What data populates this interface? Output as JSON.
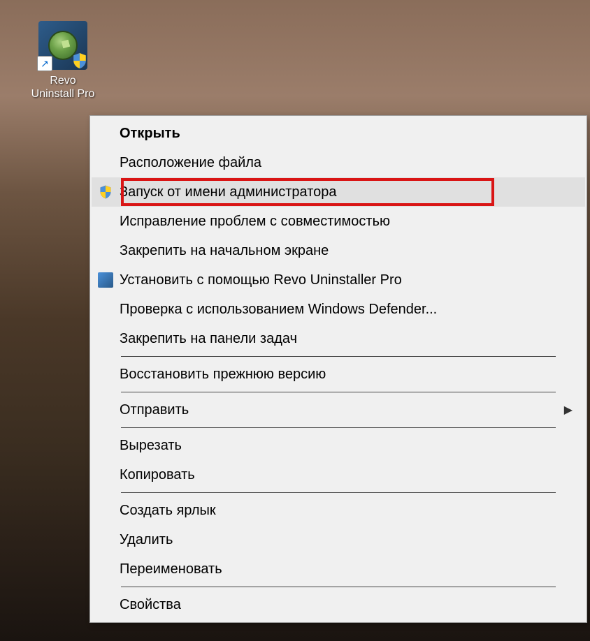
{
  "desktop": {
    "icon_label": "Revo Uninstall Pro"
  },
  "context_menu": {
    "items": [
      {
        "label": "Открыть",
        "bold": true,
        "icon": null,
        "submenu": false,
        "highlighted": false
      },
      {
        "label": "Расположение файла",
        "bold": false,
        "icon": null,
        "submenu": false,
        "highlighted": false
      },
      {
        "label": "Запуск от имени администратора",
        "bold": false,
        "icon": "shield",
        "submenu": false,
        "highlighted": true
      },
      {
        "label": "Исправление проблем с совместимостью",
        "bold": false,
        "icon": null,
        "submenu": false,
        "highlighted": false
      },
      {
        "label": "Закрепить на начальном экране",
        "bold": false,
        "icon": null,
        "submenu": false,
        "highlighted": false
      },
      {
        "label": "Установить с помощью Revo Uninstaller Pro",
        "bold": false,
        "icon": "revo",
        "submenu": false,
        "highlighted": false
      },
      {
        "label": "Проверка с использованием Windows Defender...",
        "bold": false,
        "icon": null,
        "submenu": false,
        "highlighted": false
      },
      {
        "label": "Закрепить на панели задач",
        "bold": false,
        "icon": null,
        "submenu": false,
        "highlighted": false
      },
      {
        "separator": true
      },
      {
        "label": "Восстановить прежнюю версию",
        "bold": false,
        "icon": null,
        "submenu": false,
        "highlighted": false
      },
      {
        "separator": true
      },
      {
        "label": "Отправить",
        "bold": false,
        "icon": null,
        "submenu": true,
        "highlighted": false
      },
      {
        "separator": true
      },
      {
        "label": "Вырезать",
        "bold": false,
        "icon": null,
        "submenu": false,
        "highlighted": false
      },
      {
        "label": "Копировать",
        "bold": false,
        "icon": null,
        "submenu": false,
        "highlighted": false
      },
      {
        "separator": true
      },
      {
        "label": "Создать ярлык",
        "bold": false,
        "icon": null,
        "submenu": false,
        "highlighted": false
      },
      {
        "label": "Удалить",
        "bold": false,
        "icon": null,
        "submenu": false,
        "highlighted": false
      },
      {
        "label": "Переименовать",
        "bold": false,
        "icon": null,
        "submenu": false,
        "highlighted": false
      },
      {
        "separator": true
      },
      {
        "label": "Свойства",
        "bold": false,
        "icon": null,
        "submenu": false,
        "highlighted": false
      }
    ]
  }
}
